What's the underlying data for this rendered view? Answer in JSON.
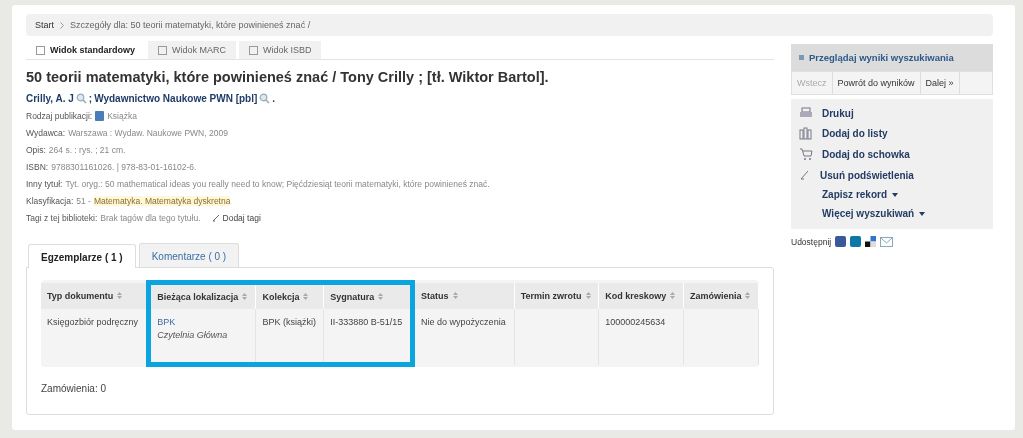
{
  "breadcrumb": [
    {
      "label": "Start",
      "kind": "link"
    },
    {
      "label": "Szczegóły dla: 50 teorii matematyki, które powinieneś znać /",
      "kind": "current"
    }
  ],
  "view_tabs": [
    {
      "label": "Widok standardowy",
      "selected": true
    },
    {
      "label": "Widok MARC",
      "selected": false
    },
    {
      "label": "Widok ISBD",
      "selected": false
    }
  ],
  "title": "50 teorii matematyki, które powinieneś znać / Tony Crilly ; [tł. Wiktor Bartol].",
  "authors": [
    {
      "name": "Crilly, A. J"
    },
    {
      "name": "Wydawnictwo Naukowe PWN [pbl]"
    }
  ],
  "authors_separator": ";",
  "authors_end": ".",
  "fields": [
    {
      "label": "Rodzaj publikacji:",
      "value": "Książka",
      "kind": "type"
    },
    {
      "label": "Wydawca:",
      "value": "Warszawa : Wydaw. Naukowe PWN, 2009",
      "kind": "text"
    },
    {
      "label": "Opis:",
      "value": "264 s. : rys. ; 21 cm.",
      "kind": "text"
    },
    {
      "label": "ISBN:",
      "value": "9788301161026. | 978-83-01-16102-6.",
      "kind": "text"
    },
    {
      "label": "Inny tytuł:",
      "value": "Tyt. oryg.: 50 mathematical ideas you really need to know; Pięćdziesiąt teorii matematyki, które powinieneś znać.",
      "kind": "text"
    },
    {
      "label": "Klasyfikacja:",
      "value": "51 -",
      "highlight": "Matematyka. Matematyka dyskretna",
      "kind": "class"
    },
    {
      "label": "Tagi z tej biblioteki:",
      "value": "Brak tagów dla tego tytułu.",
      "action": "Dodaj tagi",
      "kind": "tags"
    }
  ],
  "holding_tabs": [
    {
      "label": "Egzemplarze ( 1 )",
      "selected": true
    },
    {
      "label": "Komentarze ( 0 )",
      "selected": false
    }
  ],
  "table": {
    "columns": [
      {
        "label": "Typ dokumentu",
        "highlighted": false
      },
      {
        "label": "Bieżąca lokalizacja",
        "highlighted": true
      },
      {
        "label": "Kolekcja",
        "highlighted": true
      },
      {
        "label": "Sygnatura",
        "highlighted": true
      },
      {
        "label": "Status",
        "highlighted": false
      },
      {
        "label": "Termin zwrotu",
        "highlighted": false
      },
      {
        "label": "Kod kreskowy",
        "highlighted": false
      },
      {
        "label": "Zamówienia",
        "highlighted": false
      }
    ],
    "rows": [
      [
        {
          "text": "Księgozbiór podręczny"
        },
        {
          "text": "BPK",
          "sub": "Czytelnia Główna"
        },
        {
          "text": "BPK (książki)"
        },
        {
          "text": "II-333880 B-51/15"
        },
        {
          "text": "Nie do wypożyczenia"
        },
        {
          "text": ""
        },
        {
          "text": "100000245634"
        },
        {
          "text": ""
        }
      ]
    ]
  },
  "orders": "Zamówienia: 0",
  "sidebar": {
    "browse_title": "Przeglądaj wyniki wyszukiwania",
    "nav": [
      {
        "label": "Wstecz",
        "disabled": true
      },
      {
        "label": "Powrót do wyników",
        "disabled": false
      },
      {
        "label": "Dalej »",
        "disabled": false
      }
    ],
    "actions": [
      {
        "label": "Drukuj",
        "kind": "print"
      },
      {
        "label": "Dodaj do listy",
        "kind": "list"
      },
      {
        "label": "Dodaj do schowka",
        "kind": "cart"
      },
      {
        "label": "Usuń podświetlenia",
        "kind": "pen"
      },
      {
        "label": "Zapisz rekord",
        "kind": "dropdown"
      },
      {
        "label": "Więcej wyszukiwań",
        "kind": "dropdown"
      }
    ],
    "share_label": "Udostępnij"
  }
}
